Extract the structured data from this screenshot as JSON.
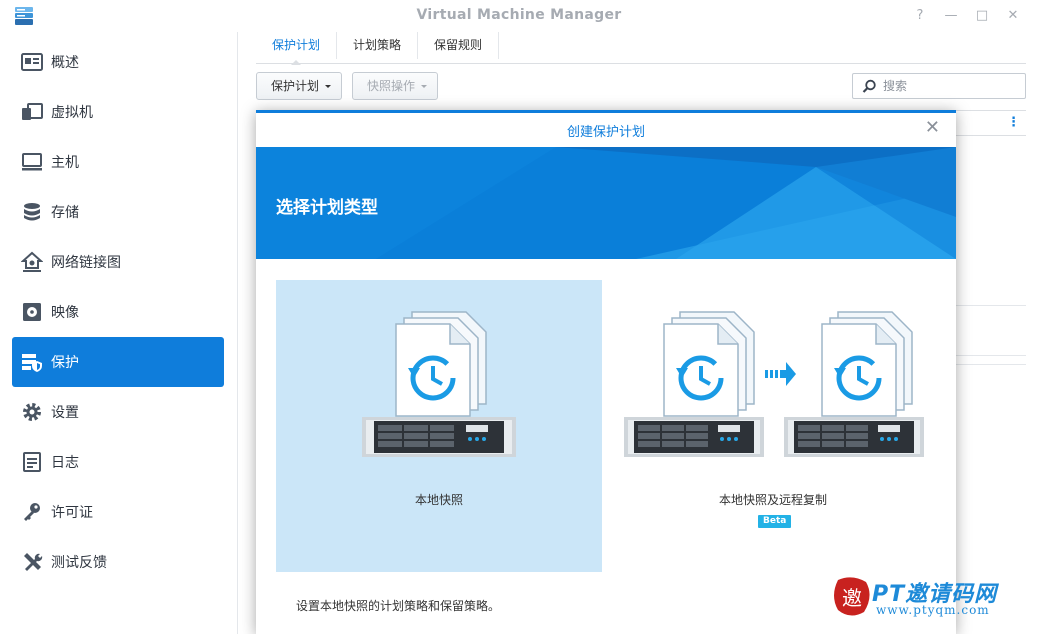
{
  "window": {
    "title": "Virtual Machine Manager",
    "icon": "vmm-app-icon",
    "controls": {
      "help": "?",
      "minimize": "—",
      "maximize": "□",
      "close": "✕"
    }
  },
  "sidebar": {
    "active_color": "#0f7ddb",
    "items": [
      {
        "label": "概述",
        "icon": "overview-icon"
      },
      {
        "label": "虚拟机",
        "icon": "virtual-machine-icon"
      },
      {
        "label": "主机",
        "icon": "host-icon"
      },
      {
        "label": "存储",
        "icon": "storage-icon"
      },
      {
        "label": "网络链接图",
        "icon": "network-icon"
      },
      {
        "label": "映像",
        "icon": "image-icon"
      },
      {
        "label": "保护",
        "icon": "protection-icon",
        "active": true
      },
      {
        "label": "设置",
        "icon": "settings-gear-icon"
      },
      {
        "label": "日志",
        "icon": "log-icon"
      },
      {
        "label": "许可证",
        "icon": "license-key-icon"
      },
      {
        "label": "测试反馈",
        "icon": "feedback-wrench-icon"
      }
    ]
  },
  "main": {
    "tabs": [
      {
        "label": "保护计划",
        "active": true
      },
      {
        "label": "计划策略"
      },
      {
        "label": "保留规则"
      }
    ],
    "toolbar": {
      "plan_button": "保护计划",
      "snapshot_button": "快照操作"
    },
    "search": {
      "placeholder": "搜索"
    }
  },
  "modal": {
    "title": "创建保护计划",
    "close": "✕",
    "banner_title": "选择计划类型",
    "options": [
      {
        "label": "本地快照",
        "selected": true
      },
      {
        "label": "本地快照及远程复制",
        "badge": "Beta"
      }
    ],
    "description": "设置本地快照的计划策略和保留策略。"
  },
  "watermark": {
    "brand": "PT邀请码网",
    "url": "www.ptyqm.com",
    "logo_glyph": "邀"
  }
}
